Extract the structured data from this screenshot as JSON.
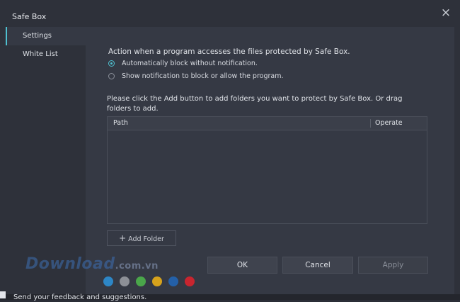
{
  "window": {
    "title": "Safe Box",
    "close_glyph": "×"
  },
  "sidebar": {
    "items": [
      {
        "label": "Settings",
        "active": true
      },
      {
        "label": "White List",
        "active": false
      }
    ]
  },
  "settings": {
    "action_heading": "Action when a program accesses the files protected by Safe Box.",
    "options": [
      {
        "label": "Automatically block without notification.",
        "checked": true
      },
      {
        "label": "Show notification to block or allow the program.",
        "checked": false
      }
    ],
    "folders_instruction": "Please click the Add button to add folders you want to protect by Safe Box. Or drag folders to add.",
    "table": {
      "columns": [
        "Path",
        "Operate"
      ],
      "rows": []
    },
    "add_folder": {
      "icon": "plus-icon",
      "label": "Add Folder"
    }
  },
  "buttons": {
    "ok": "OK",
    "cancel": "Cancel",
    "apply": "Apply"
  },
  "watermark": {
    "brand": "Download",
    "tld": ".com.vn"
  },
  "color_dots": [
    "#2d86c6",
    "#8d9097",
    "#4aa64a",
    "#d6a21c",
    "#2460a8",
    "#c8252f"
  ],
  "footer": {
    "text": "Send your feedback and suggestions."
  },
  "colors": {
    "accent": "#4fc0d0",
    "background": "#353944"
  }
}
